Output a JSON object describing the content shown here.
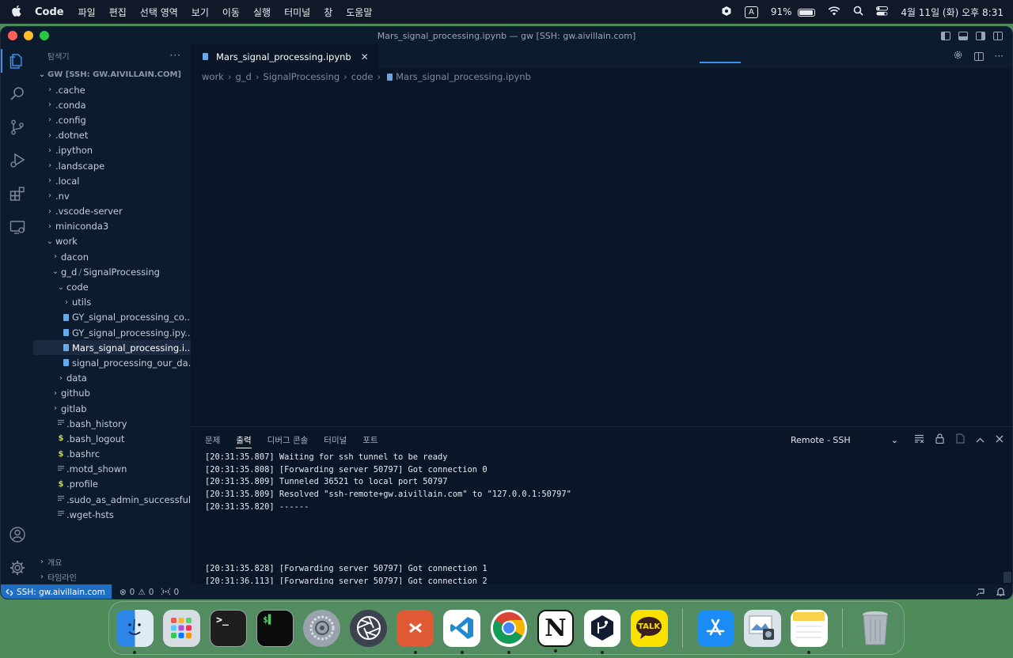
{
  "menubar": {
    "app_name": "Code",
    "menus": [
      "파일",
      "편집",
      "선택 영역",
      "보기",
      "이동",
      "실행",
      "터미널",
      "창",
      "도움말"
    ],
    "input_source": "A",
    "battery_percent": "91%",
    "battery_level": 0.91,
    "clock": "4월 11일 (화) 오후 8:31"
  },
  "window": {
    "title": "Mars_signal_processing.ipynb — gw [SSH: gw.aivillain.com]"
  },
  "sidebar": {
    "header": "탐색기",
    "root_label": "GW [SSH: GW.AIVILLAIN.COM]",
    "outline_label": "개요",
    "timeline_label": "타임라인",
    "tree": [
      {
        "label": ".cache",
        "chevron": "›",
        "icon": ""
      },
      {
        "label": ".conda",
        "chevron": "›",
        "icon": ""
      },
      {
        "label": ".config",
        "chevron": "›",
        "icon": ""
      },
      {
        "label": ".dotnet",
        "chevron": "›",
        "icon": ""
      },
      {
        "label": ".ipython",
        "chevron": "›",
        "icon": ""
      },
      {
        "label": ".landscape",
        "chevron": "›",
        "icon": ""
      },
      {
        "label": ".local",
        "chevron": "›",
        "icon": ""
      },
      {
        "label": ".nv",
        "chevron": "›",
        "icon": ""
      },
      {
        "label": ".vscode-server",
        "chevron": "›",
        "icon": ""
      },
      {
        "label": "miniconda3",
        "chevron": "›",
        "icon": ""
      },
      {
        "label": "work",
        "chevron": "⌄",
        "icon": ""
      },
      {
        "label": "dacon",
        "chevron": "›",
        "icon": ""
      },
      {
        "label": "g_d",
        "label2": "SignalProcessing",
        "chevron": "⌄",
        "icon": ""
      },
      {
        "label": "code",
        "chevron": "⌄",
        "icon": ""
      },
      {
        "label": "utils",
        "chevron": "›",
        "icon": ""
      },
      {
        "label": "GY_signal_processing_co...",
        "chevron": "",
        "icon": "notebook"
      },
      {
        "label": "GY_signal_processing.ipy...",
        "chevron": "",
        "icon": "notebook"
      },
      {
        "label": "Mars_signal_processing.i...",
        "chevron": "",
        "icon": "notebook"
      },
      {
        "label": "signal_processing_our_da...",
        "chevron": "",
        "icon": "notebook"
      },
      {
        "label": "data",
        "chevron": "›",
        "icon": ""
      },
      {
        "label": "github",
        "chevron": "›",
        "icon": ""
      },
      {
        "label": "gitlab",
        "chevron": "›",
        "icon": ""
      },
      {
        "label": ".bash_history",
        "chevron": "",
        "icon": "lines"
      },
      {
        "label": ".bash_logout",
        "chevron": "",
        "icon": "$"
      },
      {
        "label": ".bashrc",
        "chevron": "",
        "icon": "$"
      },
      {
        "label": ".motd_shown",
        "chevron": "",
        "icon": "lines"
      },
      {
        "label": ".profile",
        "chevron": "",
        "icon": "$"
      },
      {
        "label": ".sudo_as_admin_successful",
        "chevron": "",
        "icon": "lines"
      },
      {
        "label": ".wget-hsts",
        "chevron": "",
        "icon": "lines"
      }
    ]
  },
  "editor": {
    "tab_label": "Mars_signal_processing.ipynb",
    "tab_close": "✕",
    "breadcrumb": [
      "work",
      "g_d",
      "SignalProcessing",
      "code",
      "Mars_signal_processing.ipynb"
    ]
  },
  "panel": {
    "tabs": [
      "문제",
      "출력",
      "디버그 콘솔",
      "터미널",
      "포트"
    ],
    "active_tab": "출력",
    "output_channel": "Remote - SSH",
    "output_lines_top": [
      "[20:31:35.807] Waiting for ssh tunnel to be ready",
      "[20:31:35.808] [Forwarding server 50797] Got connection 0",
      "[20:31:35.809] Tunneled 36521 to local port 50797",
      "[20:31:35.809] Resolved \"ssh-remote+gw.aivillain.com\" to \"127.0.0.1:50797\"",
      "[20:31:35.820] ------"
    ],
    "output_lines_bottom": [
      "[20:31:35.828] [Forwarding server 50797] Got connection 1",
      "[20:31:36.113] [Forwarding server 50797] Got connection 2"
    ]
  },
  "statusbar": {
    "remote": "SSH: gw.aivillain.com",
    "errors": "0",
    "warnings": "0",
    "ports": "0"
  },
  "dock": {
    "apps": [
      {
        "name": "Finder",
        "running": true
      },
      {
        "name": "Launchpad",
        "running": false
      },
      {
        "name": "Terminal",
        "running": false
      },
      {
        "name": "iTerm",
        "running": false
      },
      {
        "name": "System Settings",
        "running": false
      },
      {
        "name": "Aperture",
        "running": false
      },
      {
        "name": "Microsoft Remote Desktop",
        "running": true
      },
      {
        "name": "Visual Studio Code",
        "running": true
      },
      {
        "name": "Google Chrome",
        "running": true
      },
      {
        "name": "Notion",
        "running": true
      },
      {
        "name": "Source Control App",
        "running": true
      },
      {
        "name": "KakaoTalk",
        "running": false
      },
      {
        "name": "App Store",
        "running": false
      },
      {
        "name": "Preview",
        "running": false
      },
      {
        "name": "Notes",
        "running": true
      },
      {
        "name": "Trash",
        "running": false
      }
    ],
    "kakao_label": "TALK",
    "notion_label": "N"
  },
  "colors": {
    "accent": "#3b8eea",
    "remote_badge": "#1f6fc4",
    "editor_bg": "#0a1628",
    "sidebar_bg": "#0d1b2e"
  }
}
